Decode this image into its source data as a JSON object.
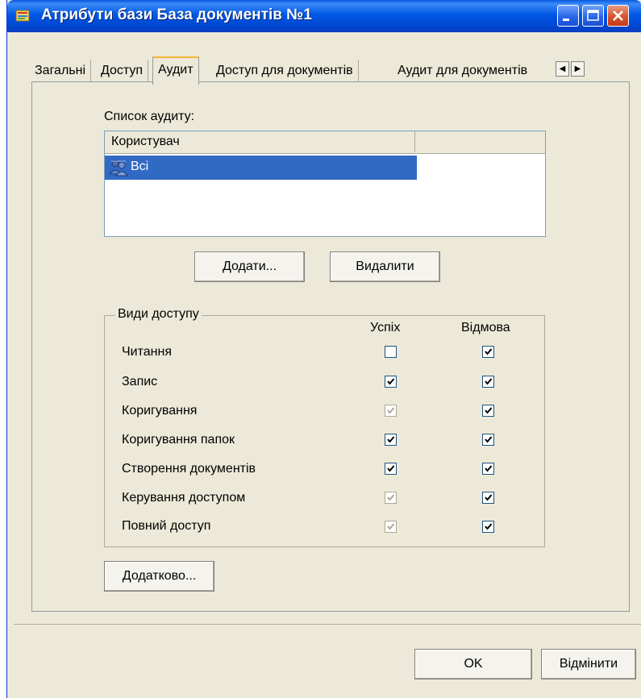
{
  "window": {
    "title": "Атрибути бази База документів №1"
  },
  "tabs": [
    {
      "label": "Загальні",
      "active": false
    },
    {
      "label": "Доступ",
      "active": false
    },
    {
      "label": "Аудит",
      "active": true
    },
    {
      "label": "Доступ для документів",
      "active": false
    },
    {
      "label": "Аудит для документів",
      "active": false
    }
  ],
  "audit_list": {
    "label": "Список аудиту:",
    "column_header": "Користувач",
    "rows": [
      {
        "name": "Всі",
        "icon": "users-group-icon",
        "selected": true
      }
    ]
  },
  "buttons": {
    "add": "Додати...",
    "remove": "Видалити",
    "advanced": "Додатково...",
    "ok": "OK",
    "cancel": "Відмінити"
  },
  "access_types": {
    "title": "Види доступу",
    "col_success": "Успіх",
    "col_failure": "Відмова",
    "rows": [
      {
        "label": "Читання",
        "success": false,
        "success_disabled": false,
        "failure": true
      },
      {
        "label": "Запис",
        "success": true,
        "success_disabled": false,
        "failure": true
      },
      {
        "label": "Коригування",
        "success": true,
        "success_disabled": true,
        "failure": true
      },
      {
        "label": "Коригування папок",
        "success": true,
        "success_disabled": false,
        "failure": true
      },
      {
        "label": "Створення документів",
        "success": true,
        "success_disabled": false,
        "failure": true
      },
      {
        "label": "Керування доступом",
        "success": true,
        "success_disabled": true,
        "failure": true
      },
      {
        "label": "Повний доступ",
        "success": true,
        "success_disabled": true,
        "failure": true
      }
    ]
  },
  "colors": {
    "titlebar": "#0058e6",
    "dialog_bg": "#ece9d8",
    "selection": "#316ac5",
    "active_tab_accent": "#f4b43a"
  }
}
